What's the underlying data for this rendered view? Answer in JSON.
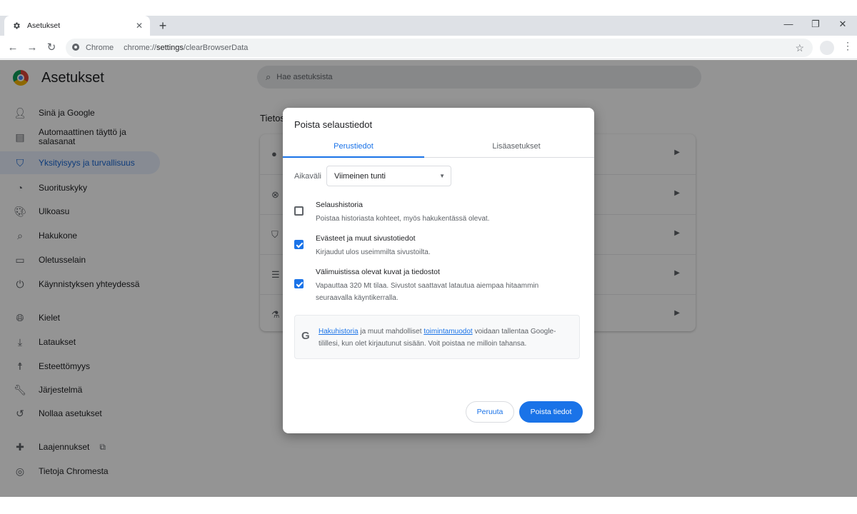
{
  "browser": {
    "tab_title": "Asetukset",
    "new_tab_glyph": "+",
    "omnibox_site": "Chrome",
    "url_host": "chrome://",
    "url_path_bold": "settings",
    "url_rest": "/clearBrowserData"
  },
  "settings": {
    "title": "Asetukset",
    "search_placeholder": "Hae asetuksista",
    "section_title_partial": "Tietos",
    "sidebar": [
      {
        "label": "Sinä ja Google",
        "icon": "person-icon"
      },
      {
        "label": "Automaattinen täyttö ja salasanat",
        "icon": "clipboard-icon"
      },
      {
        "label": "Yksityisyys ja turvallisuus",
        "icon": "shield-icon",
        "active": true
      },
      {
        "label": "Suorituskyky",
        "icon": "speedometer-icon"
      },
      {
        "label": "Ulkoasu",
        "icon": "palette-icon"
      },
      {
        "label": "Hakukone",
        "icon": "search-icon"
      },
      {
        "label": "Oletusselain",
        "icon": "browser-icon"
      },
      {
        "label": "Käynnistyksen yhteydessä",
        "icon": "power-icon"
      },
      {
        "label": "Kielet",
        "icon": "globe-icon"
      },
      {
        "label": "Lataukset",
        "icon": "download-icon"
      },
      {
        "label": "Esteettömyys",
        "icon": "accessibility-icon"
      },
      {
        "label": "Järjestelmä",
        "icon": "wrench-icon"
      },
      {
        "label": "Nollaa asetukset",
        "icon": "reset-icon"
      },
      {
        "label": "Laajennukset",
        "icon": "puzzle-icon"
      },
      {
        "label": "Tietoja Chromesta",
        "icon": "chrome-icon"
      }
    ]
  },
  "dialog": {
    "title": "Poista selaustiedot",
    "tab_basic": "Perustiedot",
    "tab_advanced": "Lisäasetukset",
    "range_label": "Aikaväli",
    "range_value": "Viimeinen tunti",
    "options": [
      {
        "title": "Selaushistoria",
        "desc": "Poistaa historiasta kohteet, myös hakukentässä olevat.",
        "checked": false
      },
      {
        "title": "Evästeet ja muut sivustotiedot",
        "desc": "Kirjaudut ulos useimmilta sivustoilta.",
        "checked": true
      },
      {
        "title": "Välimuistissa olevat kuvat ja tiedostot",
        "desc": "Vapauttaa 320 Mt tilaa. Sivustot saattavat latautua aiempaa hitaammin seuraavalla käyntikerralla.",
        "checked": true
      }
    ],
    "google_note": {
      "link1": "Hakuhistoria",
      "mid": " ja muut mahdolliset ",
      "link2": "toimintamuodot",
      "rest": " voidaan tallentaa Google-tilillesi, kun olet kirjautunut sisään. Voit poistaa ne milloin tahansa."
    },
    "cancel_label": "Peruuta",
    "confirm_label": "Poista tiedot"
  },
  "colors": {
    "accent": "#1a73e8",
    "overlay": "rgba(0,0,0,0.42)"
  }
}
